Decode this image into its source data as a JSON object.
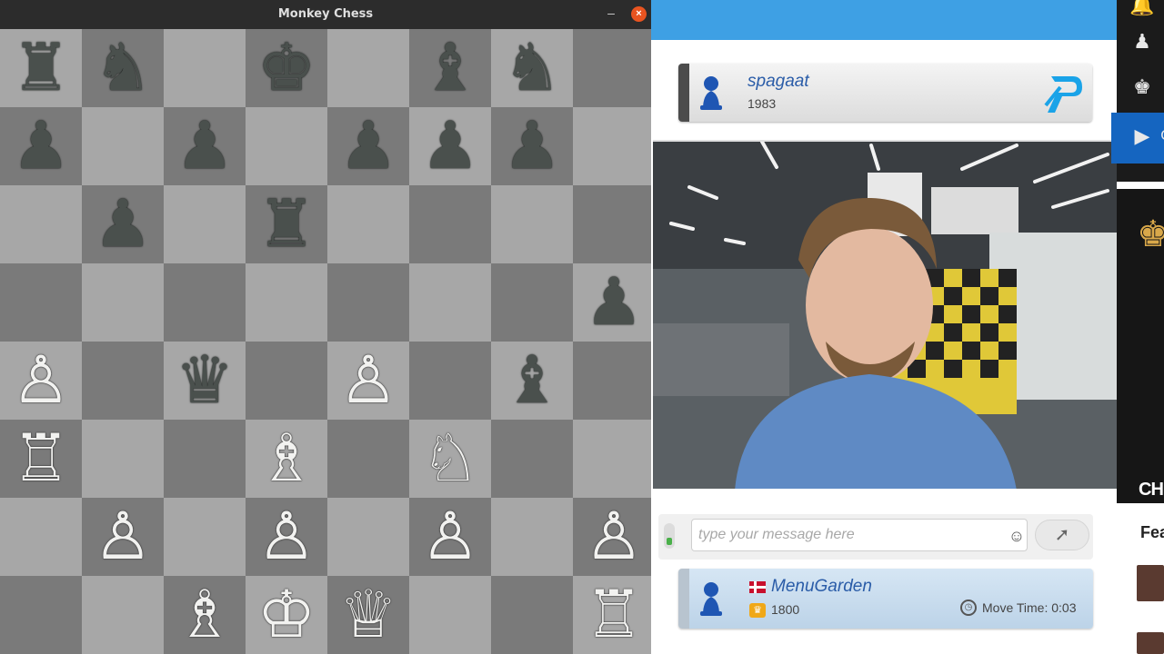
{
  "window": {
    "title": "Monkey Chess",
    "minimize_glyph": "–",
    "close_glyph": "×"
  },
  "board": {
    "light_color": "#a7a7a7",
    "dark_color": "#7a7a7a",
    "ranks": [
      [
        "br",
        "bn",
        "",
        "bk",
        "",
        "bb",
        "bn",
        ""
      ],
      [
        "bp",
        "",
        "bp",
        "",
        "bp",
        "bp",
        "bp",
        ""
      ],
      [
        "",
        "bp",
        "",
        "br",
        "",
        "",
        "",
        ""
      ],
      [
        "",
        "",
        "",
        "",
        "",
        "",
        "",
        "bp"
      ],
      [
        "wp",
        "",
        "bq",
        "",
        "wp",
        "",
        "bb",
        ""
      ],
      [
        "wr",
        "",
        "",
        "wb",
        "",
        "wn",
        "",
        ""
      ],
      [
        "",
        "wp",
        "",
        "wp",
        "",
        "wp",
        "",
        "wp"
      ],
      [
        "",
        "",
        "wb",
        "wk",
        "wq",
        "",
        "",
        "wr"
      ]
    ],
    "glyphs": {
      "br": "♜",
      "bn": "♞",
      "bb": "♝",
      "bq": "♛",
      "bk": "♚",
      "bp": "♟",
      "wr": "♖",
      "wn": "♘",
      "wb": "♗",
      "wq": "♕",
      "wk": "♔",
      "wp": "♙"
    }
  },
  "site": {
    "accent_color": "#3ea0e4",
    "top_player": {
      "name": "spagaat",
      "rating": "1983",
      "logo_icon": "chessgames-logo-icon"
    },
    "chat": {
      "placeholder": "type your message here",
      "smiley_glyph": "☺",
      "send_glyph": "➚"
    },
    "bottom_player": {
      "name": "MenuGarden",
      "rating": "1800",
      "crown_glyph": "♛",
      "move_time_label": "Move Time: 0:03",
      "clock_glyph": "◷"
    },
    "sidebar": {
      "nav_icons": [
        "🔔",
        "♟",
        "♚",
        "▶"
      ],
      "nav_active_label": "C",
      "banner_king": "♚",
      "banner_text": "CHESS",
      "featured_label": "Fea"
    }
  }
}
